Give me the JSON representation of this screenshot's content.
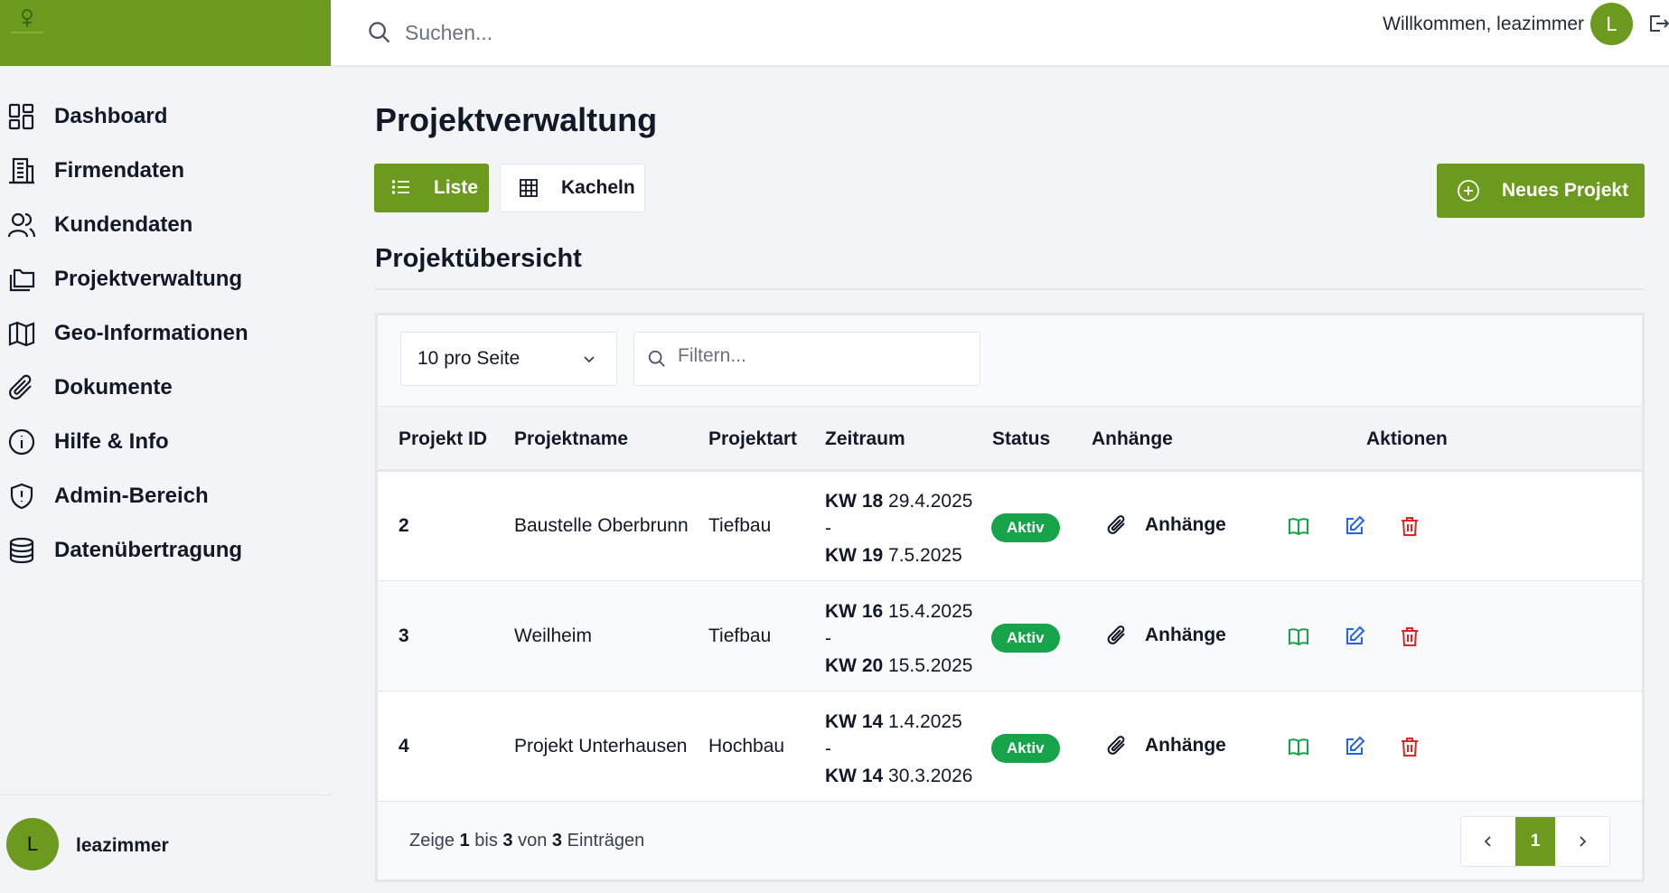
{
  "header": {
    "search_placeholder": "Suchen...",
    "welcome": "Willkommen, leazimmer",
    "avatar_initial": "L"
  },
  "sidebar": {
    "items": [
      {
        "label": "Dashboard",
        "icon": "dashboard-icon"
      },
      {
        "label": "Firmendaten",
        "icon": "building-icon"
      },
      {
        "label": "Kundendaten",
        "icon": "users-icon"
      },
      {
        "label": "Projektverwaltung",
        "icon": "folders-icon"
      },
      {
        "label": "Geo-Informationen",
        "icon": "map-icon"
      },
      {
        "label": "Dokumente",
        "icon": "paperclip-icon"
      },
      {
        "label": "Hilfe & Info",
        "icon": "info-icon"
      },
      {
        "label": "Admin-Bereich",
        "icon": "shield-icon"
      },
      {
        "label": "Datenübertragung",
        "icon": "database-icon"
      }
    ],
    "user": {
      "initial": "L",
      "name": "leazimmer"
    }
  },
  "main": {
    "title": "Projektverwaltung",
    "view_toggle": {
      "list_label": "Liste",
      "tiles_label": "Kacheln",
      "active": "Liste"
    },
    "new_project_label": "Neues Projekt",
    "section_title": "Projektübersicht",
    "per_page": "10 pro Seite",
    "filter_placeholder": "Filtern...",
    "columns": [
      "Projekt ID",
      "Projektname",
      "Projektart",
      "Zeitraum",
      "Status",
      "Anhänge",
      "Aktionen"
    ],
    "rows": [
      {
        "id": "2",
        "name": "Baustelle Oberbrunn",
        "type": "Tiefbau",
        "start_kw": "KW 18",
        "start_date": "29.4.2025",
        "separator": "-",
        "end_kw": "KW 19",
        "end_date": "7.5.2025",
        "status": "Aktiv",
        "attachments": "Anhänge"
      },
      {
        "id": "3",
        "name": "Weilheim",
        "type": "Tiefbau",
        "start_kw": "KW 16",
        "start_date": "15.4.2025",
        "separator": "-",
        "end_kw": "KW 20",
        "end_date": "15.5.2025",
        "status": "Aktiv",
        "attachments": "Anhänge"
      },
      {
        "id": "4",
        "name": "Projekt Unterhausen",
        "type": "Hochbau",
        "start_kw": "KW 14",
        "start_date": "1.4.2025",
        "separator": "-",
        "end_kw": "KW 14",
        "end_date": "30.3.2026",
        "status": "Aktiv",
        "attachments": "Anhänge"
      }
    ],
    "footer": {
      "prefix": "Zeige",
      "from": "1",
      "mid1": "bis",
      "to": "3",
      "mid2": "von",
      "total": "3",
      "suffix": "Einträgen"
    },
    "pagination": {
      "current_page": "1"
    }
  },
  "colors": {
    "brand": "#6b9a1f",
    "status_active": "#16a34a",
    "view_action": "#16a34a",
    "edit_action": "#2563eb",
    "delete_action": "#dc2626"
  }
}
